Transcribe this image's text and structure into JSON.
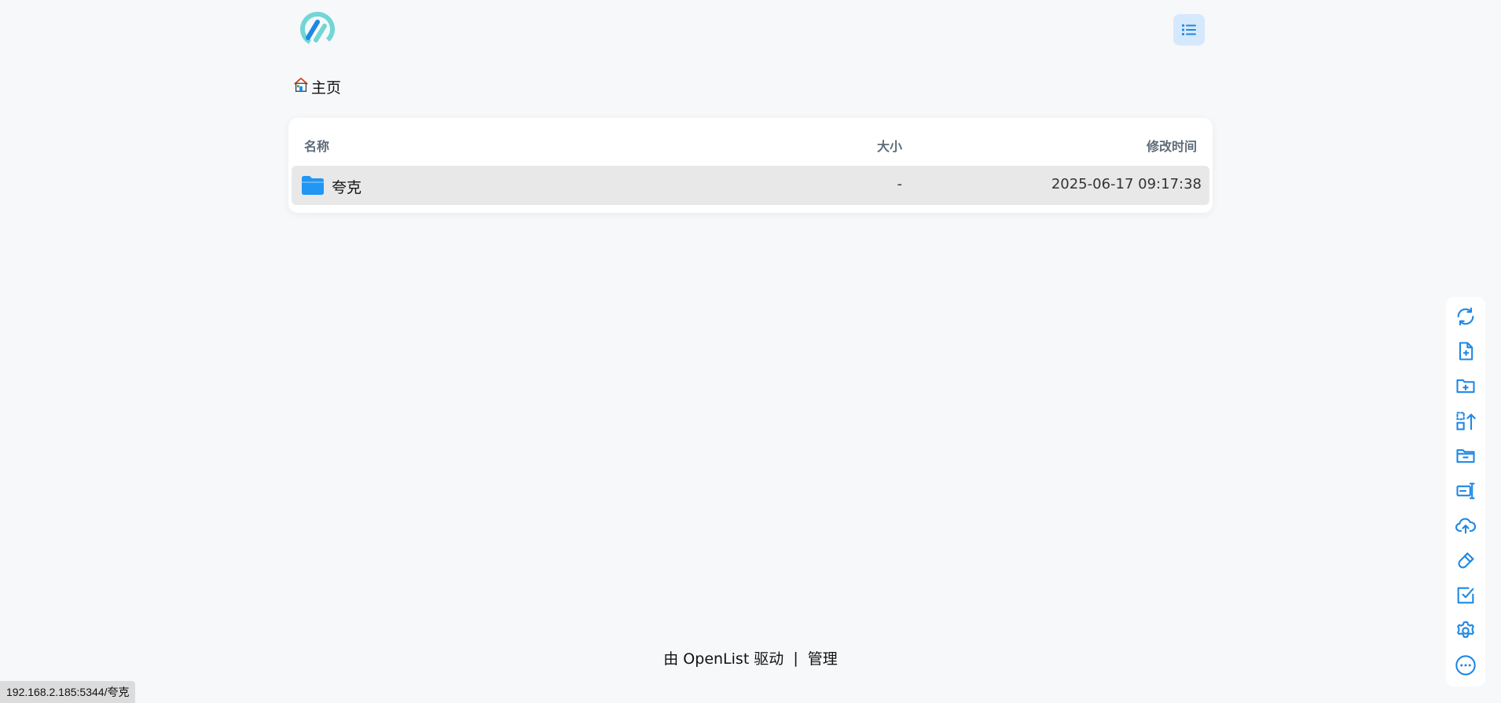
{
  "breadcrumb": {
    "home_label": "主页"
  },
  "table": {
    "headers": {
      "name": "名称",
      "size": "大小",
      "modified": "修改时间"
    },
    "rows": [
      {
        "name": "夸克",
        "size": "-",
        "modified": "2025-06-17 09:17:38",
        "icon": "folder-icon"
      }
    ]
  },
  "footer": {
    "powered_by": "由 OpenList 驱动",
    "separator": "|",
    "manage": "管理"
  },
  "status_bar": {
    "url": "192.168.2.185:5344/夸克"
  },
  "colors": {
    "accent": "#1e88e5",
    "toggle_bg": "#d6e8fc",
    "page_bg": "#f7f8fa",
    "row_hover": "#e8e8e8"
  }
}
